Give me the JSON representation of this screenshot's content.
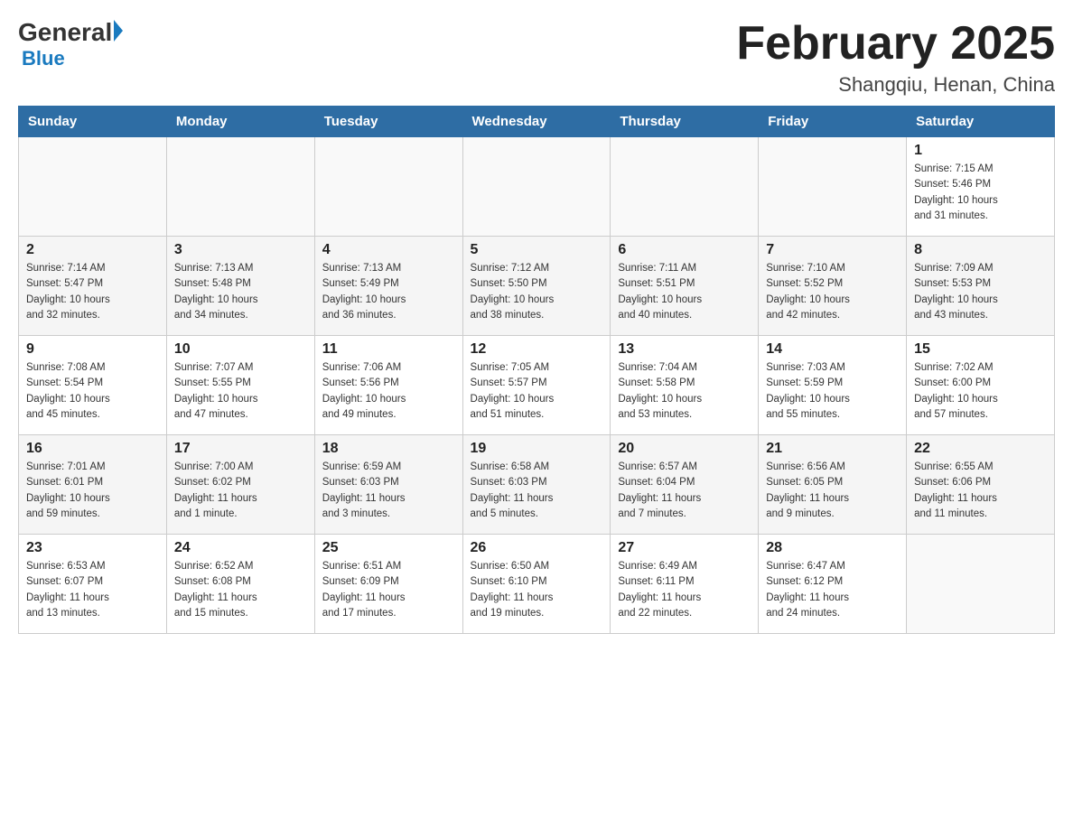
{
  "header": {
    "logo": {
      "general": "General",
      "blue": "Blue"
    },
    "title": "February 2025",
    "location": "Shangqiu, Henan, China"
  },
  "weekdays": [
    "Sunday",
    "Monday",
    "Tuesday",
    "Wednesday",
    "Thursday",
    "Friday",
    "Saturday"
  ],
  "weeks": [
    [
      {
        "day": "",
        "info": ""
      },
      {
        "day": "",
        "info": ""
      },
      {
        "day": "",
        "info": ""
      },
      {
        "day": "",
        "info": ""
      },
      {
        "day": "",
        "info": ""
      },
      {
        "day": "",
        "info": ""
      },
      {
        "day": "1",
        "info": "Sunrise: 7:15 AM\nSunset: 5:46 PM\nDaylight: 10 hours\nand 31 minutes."
      }
    ],
    [
      {
        "day": "2",
        "info": "Sunrise: 7:14 AM\nSunset: 5:47 PM\nDaylight: 10 hours\nand 32 minutes."
      },
      {
        "day": "3",
        "info": "Sunrise: 7:13 AM\nSunset: 5:48 PM\nDaylight: 10 hours\nand 34 minutes."
      },
      {
        "day": "4",
        "info": "Sunrise: 7:13 AM\nSunset: 5:49 PM\nDaylight: 10 hours\nand 36 minutes."
      },
      {
        "day": "5",
        "info": "Sunrise: 7:12 AM\nSunset: 5:50 PM\nDaylight: 10 hours\nand 38 minutes."
      },
      {
        "day": "6",
        "info": "Sunrise: 7:11 AM\nSunset: 5:51 PM\nDaylight: 10 hours\nand 40 minutes."
      },
      {
        "day": "7",
        "info": "Sunrise: 7:10 AM\nSunset: 5:52 PM\nDaylight: 10 hours\nand 42 minutes."
      },
      {
        "day": "8",
        "info": "Sunrise: 7:09 AM\nSunset: 5:53 PM\nDaylight: 10 hours\nand 43 minutes."
      }
    ],
    [
      {
        "day": "9",
        "info": "Sunrise: 7:08 AM\nSunset: 5:54 PM\nDaylight: 10 hours\nand 45 minutes."
      },
      {
        "day": "10",
        "info": "Sunrise: 7:07 AM\nSunset: 5:55 PM\nDaylight: 10 hours\nand 47 minutes."
      },
      {
        "day": "11",
        "info": "Sunrise: 7:06 AM\nSunset: 5:56 PM\nDaylight: 10 hours\nand 49 minutes."
      },
      {
        "day": "12",
        "info": "Sunrise: 7:05 AM\nSunset: 5:57 PM\nDaylight: 10 hours\nand 51 minutes."
      },
      {
        "day": "13",
        "info": "Sunrise: 7:04 AM\nSunset: 5:58 PM\nDaylight: 10 hours\nand 53 minutes."
      },
      {
        "day": "14",
        "info": "Sunrise: 7:03 AM\nSunset: 5:59 PM\nDaylight: 10 hours\nand 55 minutes."
      },
      {
        "day": "15",
        "info": "Sunrise: 7:02 AM\nSunset: 6:00 PM\nDaylight: 10 hours\nand 57 minutes."
      }
    ],
    [
      {
        "day": "16",
        "info": "Sunrise: 7:01 AM\nSunset: 6:01 PM\nDaylight: 10 hours\nand 59 minutes."
      },
      {
        "day": "17",
        "info": "Sunrise: 7:00 AM\nSunset: 6:02 PM\nDaylight: 11 hours\nand 1 minute."
      },
      {
        "day": "18",
        "info": "Sunrise: 6:59 AM\nSunset: 6:03 PM\nDaylight: 11 hours\nand 3 minutes."
      },
      {
        "day": "19",
        "info": "Sunrise: 6:58 AM\nSunset: 6:03 PM\nDaylight: 11 hours\nand 5 minutes."
      },
      {
        "day": "20",
        "info": "Sunrise: 6:57 AM\nSunset: 6:04 PM\nDaylight: 11 hours\nand 7 minutes."
      },
      {
        "day": "21",
        "info": "Sunrise: 6:56 AM\nSunset: 6:05 PM\nDaylight: 11 hours\nand 9 minutes."
      },
      {
        "day": "22",
        "info": "Sunrise: 6:55 AM\nSunset: 6:06 PM\nDaylight: 11 hours\nand 11 minutes."
      }
    ],
    [
      {
        "day": "23",
        "info": "Sunrise: 6:53 AM\nSunset: 6:07 PM\nDaylight: 11 hours\nand 13 minutes."
      },
      {
        "day": "24",
        "info": "Sunrise: 6:52 AM\nSunset: 6:08 PM\nDaylight: 11 hours\nand 15 minutes."
      },
      {
        "day": "25",
        "info": "Sunrise: 6:51 AM\nSunset: 6:09 PM\nDaylight: 11 hours\nand 17 minutes."
      },
      {
        "day": "26",
        "info": "Sunrise: 6:50 AM\nSunset: 6:10 PM\nDaylight: 11 hours\nand 19 minutes."
      },
      {
        "day": "27",
        "info": "Sunrise: 6:49 AM\nSunset: 6:11 PM\nDaylight: 11 hours\nand 22 minutes."
      },
      {
        "day": "28",
        "info": "Sunrise: 6:47 AM\nSunset: 6:12 PM\nDaylight: 11 hours\nand 24 minutes."
      },
      {
        "day": "",
        "info": ""
      }
    ]
  ]
}
